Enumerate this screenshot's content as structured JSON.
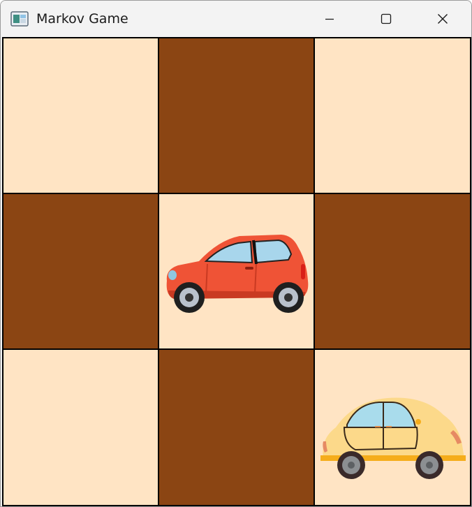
{
  "window": {
    "title": "Markov Game",
    "app_icon": "window-app-icon",
    "controls": [
      "minimize-icon",
      "maximize-icon",
      "close-icon"
    ]
  },
  "board": {
    "rows": 3,
    "cols": 3,
    "colors": {
      "light": "#ffe4c4",
      "dark": "#8b4513",
      "grid_line": "#000000"
    },
    "cells": [
      [
        "light",
        "dark",
        "light"
      ],
      [
        "dark",
        "light",
        "dark"
      ],
      [
        "light",
        "dark",
        "light"
      ]
    ],
    "pieces": [
      {
        "name": "red-car",
        "row": 1,
        "col": 1,
        "color": "#ef5336"
      },
      {
        "name": "yellow-car",
        "row": 2,
        "col": 2,
        "color": "#fcd98a"
      }
    ]
  }
}
